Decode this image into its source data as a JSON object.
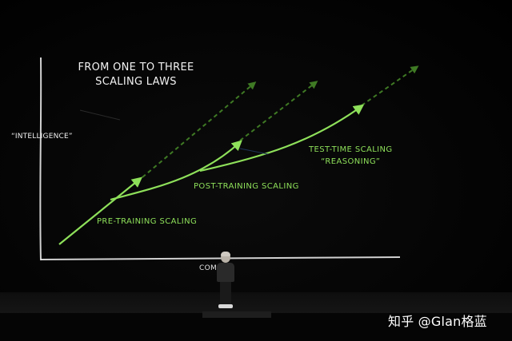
{
  "slide": {
    "title_line1": "FROM ONE TO THREE",
    "title_line2": "SCALING LAWS",
    "y_axis_label": "“INTELLIGENCE”",
    "x_axis_label": "COM",
    "labels": {
      "pre_training": "PRE-TRAINING SCALING",
      "post_training": "POST-TRAINING SCALING",
      "test_time_line1": "TEST-TIME SCALING",
      "test_time_line2": "“REASONING”"
    }
  },
  "colors": {
    "accent_green": "#7fd23f",
    "chalk_white": "#e8e8e8",
    "background": "#000000"
  },
  "watermark": "知乎 @Glan格蓝"
}
